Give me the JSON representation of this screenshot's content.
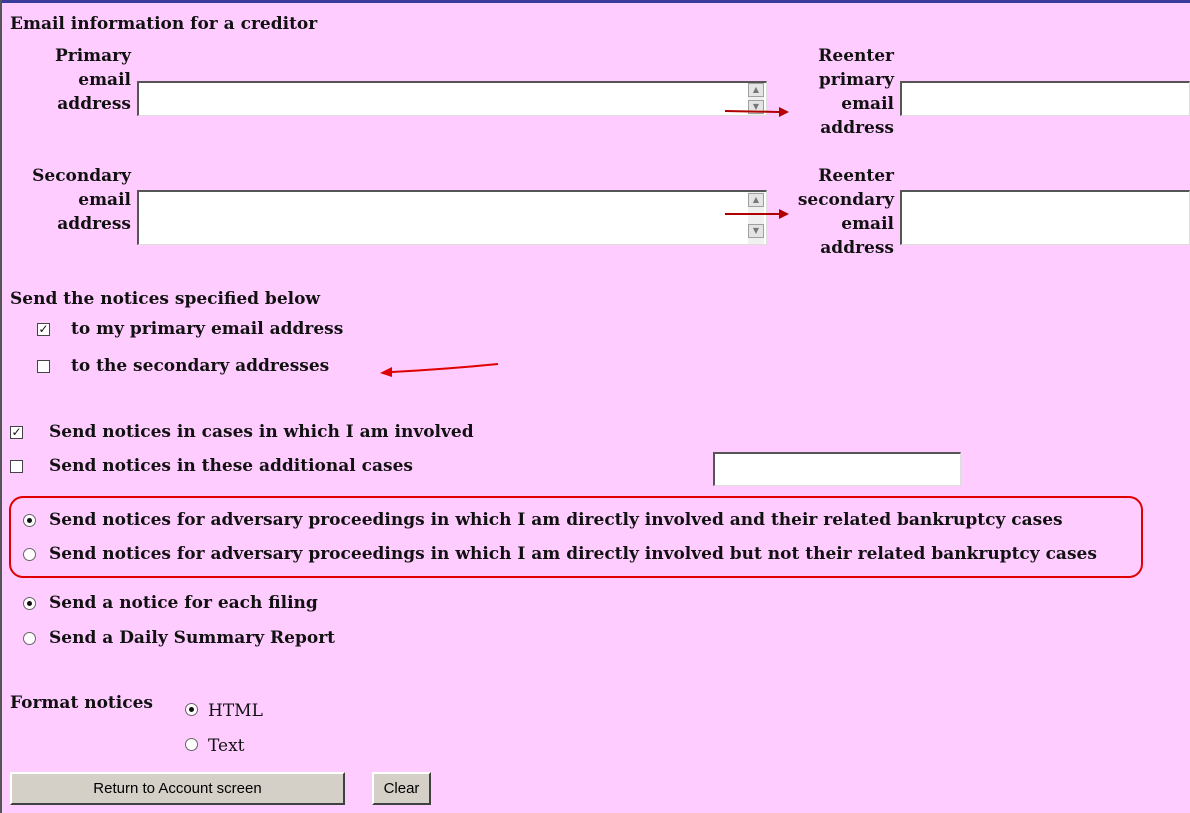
{
  "section": {
    "title": "Email information for a creditor"
  },
  "primary": {
    "label_lines": [
      "Primary",
      "email",
      "address"
    ],
    "value": "",
    "reenter_label_lines": [
      "Reenter",
      "primary",
      "email",
      "address"
    ],
    "reenter_value": ""
  },
  "secondary": {
    "label_lines": [
      "Secondary",
      "email",
      "address"
    ],
    "value": "",
    "reenter_label_lines": [
      "Reenter",
      "secondary",
      "email",
      "address"
    ],
    "reenter_value": ""
  },
  "notices": {
    "heading": "Send the notices specified below",
    "to_primary": {
      "label": "to my primary email address",
      "checked": true
    },
    "to_secondary": {
      "label": "to the secondary addresses",
      "checked": false
    }
  },
  "cases": {
    "involved": {
      "label": "Send notices in cases in which I am involved",
      "checked": true
    },
    "additional": {
      "label": "Send notices in these additional cases",
      "checked": false,
      "value": ""
    }
  },
  "adversary": {
    "options": [
      {
        "label": "Send notices for adversary proceedings in which I am directly involved and their related bankruptcy cases",
        "selected": true
      },
      {
        "label": "Send notices for adversary proceedings in which I am directly involved but not their related bankruptcy cases",
        "selected": false
      }
    ]
  },
  "frequency": {
    "options": [
      {
        "label": "Send a notice for each filing",
        "selected": true
      },
      {
        "label": "Send a Daily Summary Report",
        "selected": false
      }
    ]
  },
  "format": {
    "label": "Format notices",
    "options": [
      {
        "label": "HTML",
        "selected": true
      },
      {
        "label": "Text",
        "selected": false
      }
    ]
  },
  "buttons": {
    "return_label": "Return to Account screen",
    "clear_label": "Clear"
  },
  "colors": {
    "background": "#ffccff",
    "annotation": "#e00000"
  }
}
